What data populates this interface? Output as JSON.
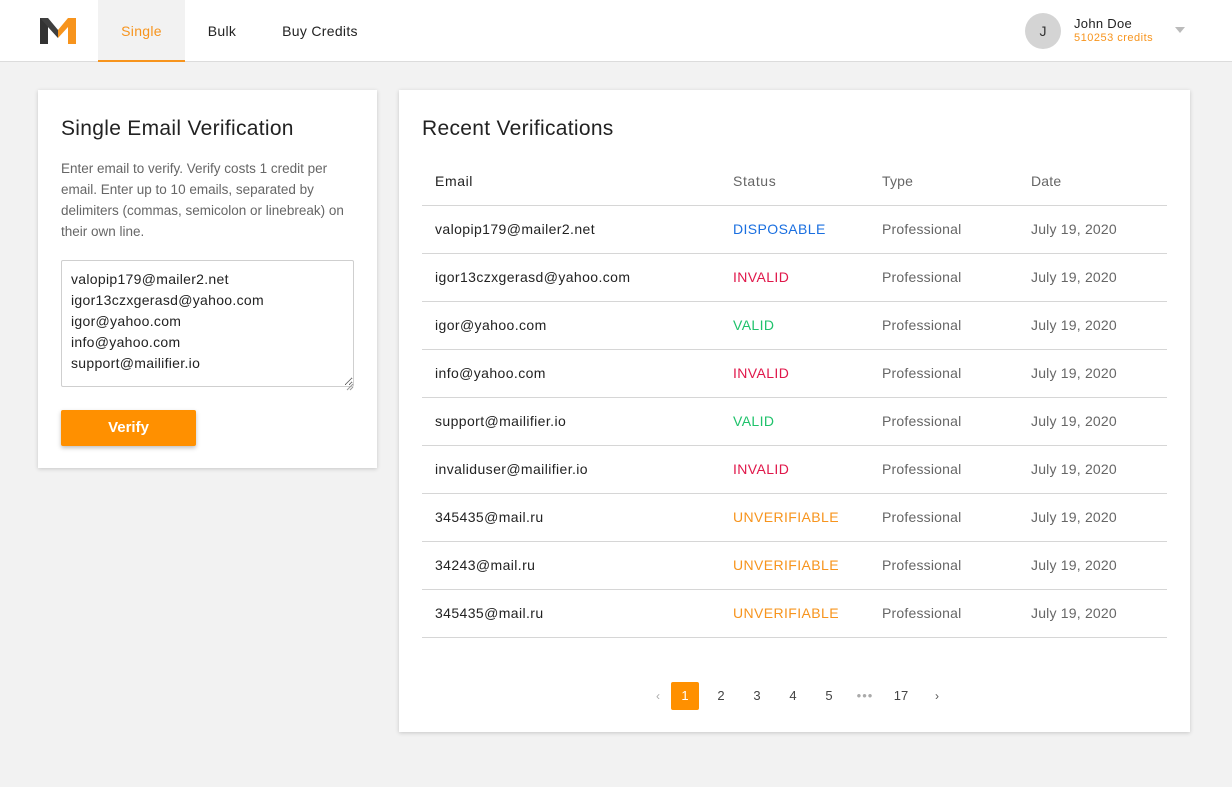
{
  "nav": {
    "tabs": [
      {
        "label": "Single"
      },
      {
        "label": "Bulk"
      },
      {
        "label": "Buy Credits"
      }
    ]
  },
  "user": {
    "initial": "J",
    "name": "John Doe",
    "credits": "510253 credits"
  },
  "single": {
    "title": "Single Email Verification",
    "description": "Enter email to verify. Verify costs 1 credit per email. Enter up to 10 emails, separated by delimiters (commas, semicolon or linebreak) on their own line.",
    "textarea_value": "valopip179@mailer2.net\nigor13czxgerasd@yahoo.com\nigor@yahoo.com\ninfo@yahoo.com\nsupport@mailifier.io",
    "verify_label": "Verify"
  },
  "recent": {
    "title": "Recent Verifications",
    "columns": [
      "Email",
      "Status",
      "Type",
      "Date"
    ],
    "rows": [
      {
        "email": "valopip179@mailer2.net",
        "status": "DISPOSABLE",
        "type": "Professional",
        "date": "July 19, 2020"
      },
      {
        "email": "igor13czxgerasd@yahoo.com",
        "status": "INVALID",
        "type": "Professional",
        "date": "July 19, 2020"
      },
      {
        "email": "igor@yahoo.com",
        "status": "VALID",
        "type": "Professional",
        "date": "July 19, 2020"
      },
      {
        "email": "info@yahoo.com",
        "status": "INVALID",
        "type": "Professional",
        "date": "July 19, 2020"
      },
      {
        "email": "support@mailifier.io",
        "status": "VALID",
        "type": "Professional",
        "date": "July 19, 2020"
      },
      {
        "email": "invaliduser@mailifier.io",
        "status": "INVALID",
        "type": "Professional",
        "date": "July 19, 2020"
      },
      {
        "email": "345435@mail.ru",
        "status": "UNVERIFIABLE",
        "type": "Professional",
        "date": "July 19, 2020"
      },
      {
        "email": "34243@mail.ru",
        "status": "UNVERIFIABLE",
        "type": "Professional",
        "date": "July 19, 2020"
      },
      {
        "email": "345435@mail.ru",
        "status": "UNVERIFIABLE",
        "type": "Professional",
        "date": "July 19, 2020"
      }
    ]
  },
  "status_colors": {
    "DISPOSABLE": "#1a6fe0",
    "INVALID": "#e0174a",
    "VALID": "#1fc26b",
    "UNVERIFIABLE": "#f7941d"
  },
  "pagination": {
    "prev_icon": "chevron-left-icon",
    "next_icon": "chevron-right-icon",
    "pages": [
      "1",
      "2",
      "3",
      "4",
      "5"
    ],
    "ellipsis": "•••",
    "last_page": "17",
    "current": "1"
  },
  "brand": {
    "accent": "#ff9000",
    "logo_dark": "#333333"
  }
}
